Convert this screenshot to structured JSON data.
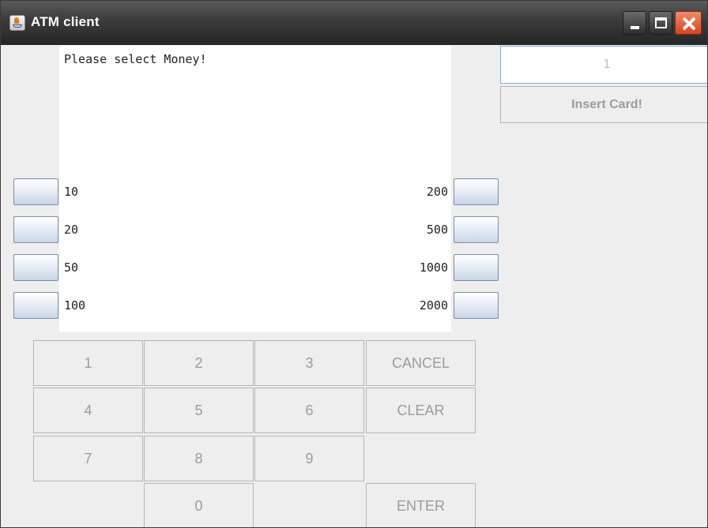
{
  "window": {
    "title": "ATM client",
    "controls": [
      "minimize",
      "maximize",
      "close"
    ],
    "title_bar_color": "#2e2e2e",
    "close_color": "#e0532a"
  },
  "screen": {
    "message": "Please select Money!",
    "options_left": [
      "10",
      "20",
      "50",
      "100"
    ],
    "options_right": [
      "200",
      "500",
      "1000",
      "2000"
    ]
  },
  "keypad": {
    "digits": [
      "1",
      "2",
      "3",
      "4",
      "5",
      "6",
      "7",
      "8",
      "9",
      "0"
    ],
    "cancel": "CANCEL",
    "clear": "CLEAR",
    "enter": "ENTER"
  },
  "card": {
    "number_value": "1",
    "insert_label": "Insert Card!"
  }
}
